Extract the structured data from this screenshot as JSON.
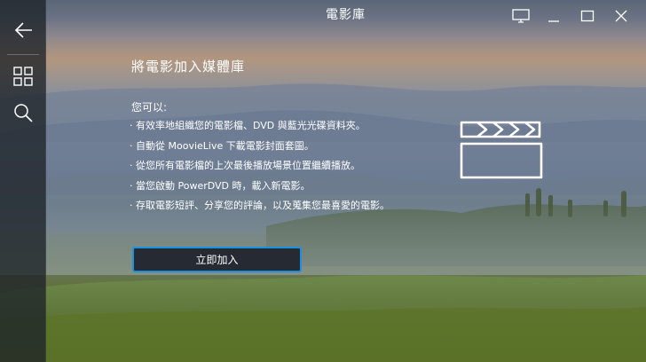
{
  "window": {
    "title": "電影庫"
  },
  "sidebar": {
    "items": [
      {
        "name": "back",
        "icon": "back-arrow-icon"
      },
      {
        "name": "grid",
        "icon": "grid-icon"
      },
      {
        "name": "search",
        "icon": "search-icon"
      }
    ]
  },
  "window_controls": {
    "icons": [
      "display-icon",
      "minimize-icon",
      "maximize-icon",
      "close-icon"
    ]
  },
  "main": {
    "heading": "將電影加入媒體庫",
    "intro": "您可以:",
    "bullet": "·",
    "features": [
      "有效率地組織您的電影檔、DVD 與藍光光碟資料夾。",
      "自動從 MoovieLive 下載電影封面套圖。",
      "從您所有電影檔的上次最後播放場景位置繼續播放。",
      "當您啟動 PowerDVD 時，載入新電影。",
      "存取電影短評、分享您的評論，以及蒐集您最喜愛的電影。"
    ],
    "add_button": "立即加入",
    "illustration_icon": "clapperboard-icon"
  },
  "colors": {
    "accent": "#1f8fe0",
    "sidebar_bg": "#1e2228",
    "button_bg": "#262a33"
  }
}
